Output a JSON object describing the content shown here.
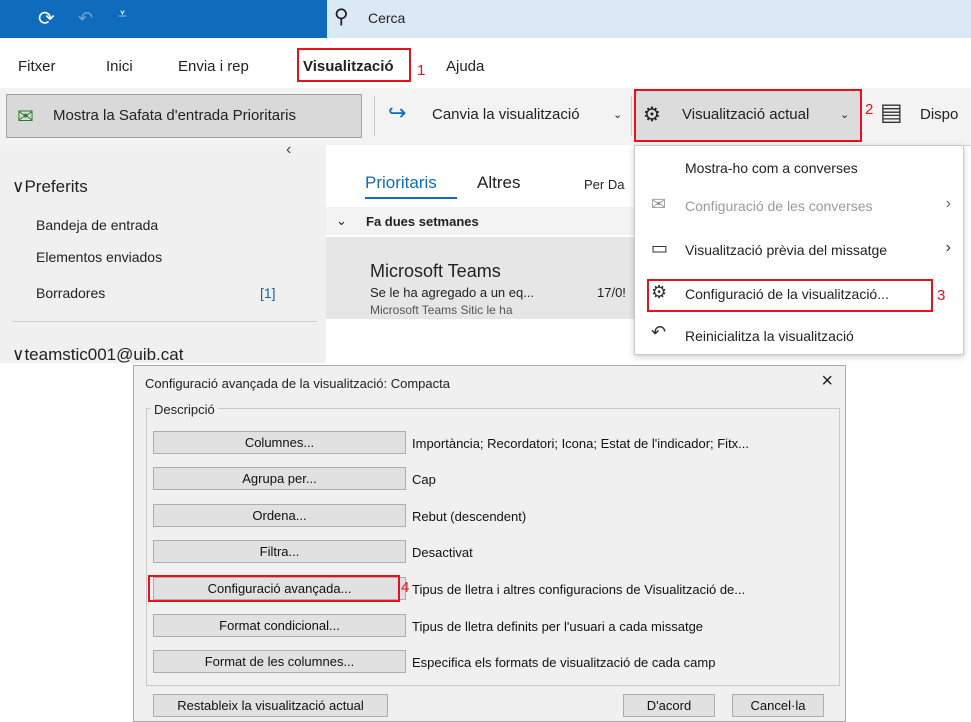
{
  "titlebar": {
    "search_placeholder": "Cerca",
    "accent": "#0f6cbd"
  },
  "tabs": [
    {
      "label": "Fitxer"
    },
    {
      "label": "Inici"
    },
    {
      "label": "Envia i rep"
    },
    {
      "label": "Visualització"
    },
    {
      "label": "Ajuda"
    }
  ],
  "ribbon": {
    "focused_inbox": "Mostra la Safata d'entrada Prioritaris",
    "change_view": "Canvia la visualització",
    "current_view": "Visualització actual",
    "layout": "Dispo"
  },
  "nav": {
    "favorites": "Preferits",
    "items": [
      {
        "label": "Bandeja de entrada",
        "count": ""
      },
      {
        "label": "Elementos enviados",
        "count": ""
      },
      {
        "label": "Borradores",
        "count": "[1]"
      }
    ],
    "account": "teamstic001@uib.cat"
  },
  "mail_list": {
    "tab_focused": "Prioritaris",
    "tab_other": "Altres",
    "sort": "Per Da",
    "group": "Fa dues setmanes",
    "message": {
      "sender": "Microsoft Teams",
      "subject": "Se le ha agregado a un eq...",
      "date": "17/0!",
      "preview": "Microsoft Teams  Sitic le ha"
    }
  },
  "dropdown": {
    "items": [
      {
        "label": "Mostra-ho com a converses"
      },
      {
        "label": "Configuració de les converses"
      },
      {
        "label": "Visualització prèvia del missatge"
      },
      {
        "label": "Configuració de la visualització..."
      },
      {
        "label": "Reinicialitza la visualització"
      }
    ]
  },
  "annotations": {
    "n1": "1",
    "n2": "2",
    "n3": "3",
    "n4": "4",
    "color": "#e8101b"
  },
  "dialog": {
    "title": "Configuració avançada de la visualització: Compacta",
    "close": "×",
    "legend": "Descripció",
    "rows": [
      {
        "button": "Columnes...",
        "desc": "Importància; Recordatori; Icona; Estat de l'indicador; Fitx..."
      },
      {
        "button": "Agrupa per...",
        "desc": "Cap"
      },
      {
        "button": "Ordena...",
        "desc": "Rebut (descendent)"
      },
      {
        "button": "Filtra...",
        "desc": "Desactivat"
      },
      {
        "button": "Configuració avançada...",
        "desc": "Tipus de lletra i altres configuracions de Visualització de..."
      },
      {
        "button": "Format condicional...",
        "desc": "Tipus de lletra definits per l'usuari a cada missatge"
      },
      {
        "button": "Format de les columnes...",
        "desc": "Especifica els formats de visualització de cada camp"
      }
    ],
    "reset": "Restableix la visualització actual",
    "ok": "D'acord",
    "cancel": "Cancel·la"
  }
}
